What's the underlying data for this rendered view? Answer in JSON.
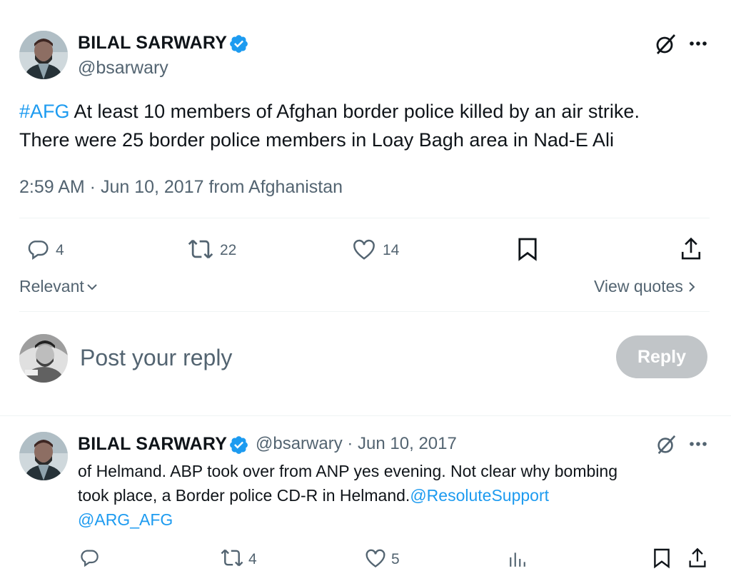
{
  "main_tweet": {
    "author_name": "BILAL SARWARY",
    "handle": "@bsarwary",
    "hashtag": "#AFG",
    "text_line1_rest": " At least 10 members of Afghan border police killed by an air strike.",
    "text_line2": "There were 25 border police members in Loay Bagh area in Nad-E Ali",
    "timestamp": "2:59 AM · Jun 10, 2017 from Afghanistan",
    "replies": "4",
    "retweets": "22",
    "likes": "14"
  },
  "controls": {
    "sort_label": "Relevant",
    "view_quotes": "View quotes"
  },
  "composer": {
    "placeholder": "Post your reply",
    "reply_button": "Reply"
  },
  "reply_tweet": {
    "author_name": "BILAL SARWARY",
    "handle_date": "@bsarwary · Jun 10, 2017",
    "line1": "of Helmand. ABP took over from ANP yes evening. Not clear why bombing",
    "line2_text": "took place, a Border police CD-R in Helmand.",
    "mention1": "@ResoluteSupport",
    "mention2": "@ARG_AFG",
    "retweets": "4",
    "likes": "5"
  },
  "colors": {
    "accent": "#1d9bf0",
    "secondary_text": "#536471",
    "verified": "#1d9bf0"
  },
  "icons": [
    "verified-badge-icon",
    "grok-icon",
    "more-icon",
    "reply-icon",
    "retweet-icon",
    "like-icon",
    "bookmark-icon",
    "share-icon",
    "chevron-down-icon",
    "chevron-right-icon",
    "views-icon"
  ]
}
